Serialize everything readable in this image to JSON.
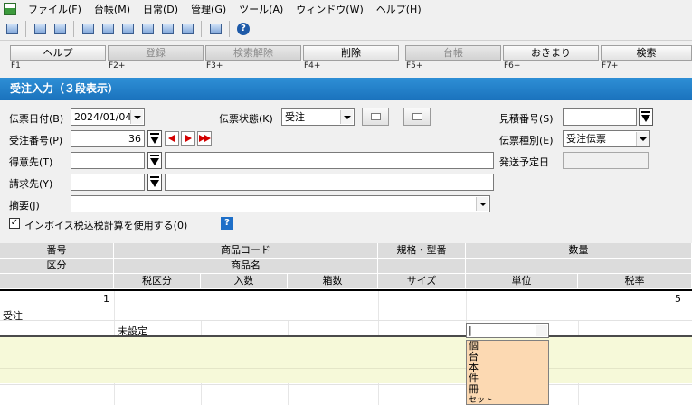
{
  "menu": [
    "ファイル(F)",
    "台帳(M)",
    "日常(D)",
    "管理(G)",
    "ツール(A)",
    "ウィンドウ(W)",
    "ヘルプ(H)"
  ],
  "function_keys": [
    {
      "label": "ヘルプ",
      "key": "F1"
    },
    {
      "label": "登録",
      "key": "F2+"
    },
    {
      "label": "検索解除",
      "key": "F3+"
    },
    {
      "label": "削除",
      "key": "F4+"
    },
    {
      "label": "台帳",
      "key": "F5+"
    },
    {
      "label": "おきまり",
      "key": "F6+"
    },
    {
      "label": "検索",
      "key": "F7+"
    }
  ],
  "title": "受注入力（３段表示）",
  "form": {
    "slip_date_label": "伝票日付(B)",
    "slip_date_value": "2024/01/04",
    "slip_status_label": "伝票状態(K)",
    "slip_status_value": "受注",
    "estimate_no_label": "見積番号(S)",
    "order_no_label": "受注番号(P)",
    "order_no_value": "36",
    "slip_type_label": "伝票種別(E)",
    "slip_type_value": "受注伝票",
    "customer_label": "得意先(T)",
    "ship_date_label": "発送予定日",
    "billing_label": "請求先(Y)",
    "summary_label": "摘要(J)",
    "invoice_check_label": "インボイス税込税計算を使用する(0)",
    "invoice_checked": "✓",
    "help_glyph": "?"
  },
  "grid": {
    "header_row1": [
      "番号",
      "商品コード",
      "規格・型番",
      "数量"
    ],
    "header_row2": [
      "区分",
      "商品名"
    ],
    "header_row3": [
      "税区分",
      "入数",
      "箱数",
      "サイズ",
      "単位",
      "税率"
    ],
    "row": {
      "number": "1",
      "tax_rate_col": "5",
      "category": "受注",
      "tax_class": "未設定"
    }
  },
  "unit_dropdown": {
    "value": "|",
    "options": [
      "個",
      "台",
      "本",
      "件",
      "冊",
      "セット"
    ]
  }
}
